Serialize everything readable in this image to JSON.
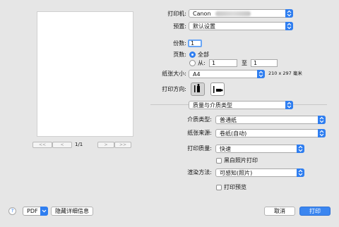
{
  "preview": {
    "first_label": "<<",
    "prev_label": "<",
    "page_indicator": "1/1",
    "next_label": ">",
    "last_label": ">>"
  },
  "printer": {
    "label": "打印机:",
    "value": "Canon"
  },
  "presets": {
    "label": "预置:",
    "value": "默认设置"
  },
  "copies": {
    "label": "份数:",
    "value": "1"
  },
  "pages": {
    "label": "页数:",
    "all_label": "全部",
    "from_label": "从:",
    "from_value": "1",
    "to_label": "至",
    "to_value": "1",
    "selected": "all"
  },
  "paper_size": {
    "label": "纸张大小:",
    "value": "A4",
    "dimensions": "210 x 297 毫米"
  },
  "orientation": {
    "label": "打印方向:",
    "selected": "portrait"
  },
  "section": {
    "value": "质量与介质类型"
  },
  "media_type": {
    "label": "介质类型:",
    "value": "普通纸"
  },
  "paper_source": {
    "label": "纸张来源:",
    "value": "卷纸(自动)"
  },
  "print_quality": {
    "label": "打印质量:",
    "value": "快速"
  },
  "grayscale": {
    "label": "黑白照片打印",
    "checked": false
  },
  "rendering": {
    "label": "渲染方法:",
    "value": "可感知(照片)"
  },
  "print_preview": {
    "label": "打印预览",
    "checked": false
  },
  "footer": {
    "help_label": "?",
    "pdf_label": "PDF",
    "hide_details_label": "隐藏详细信息",
    "cancel_label": "取消",
    "print_label": "打印"
  },
  "colors": {
    "accent": "#2f7ef0",
    "background": "#e6e6e6"
  }
}
